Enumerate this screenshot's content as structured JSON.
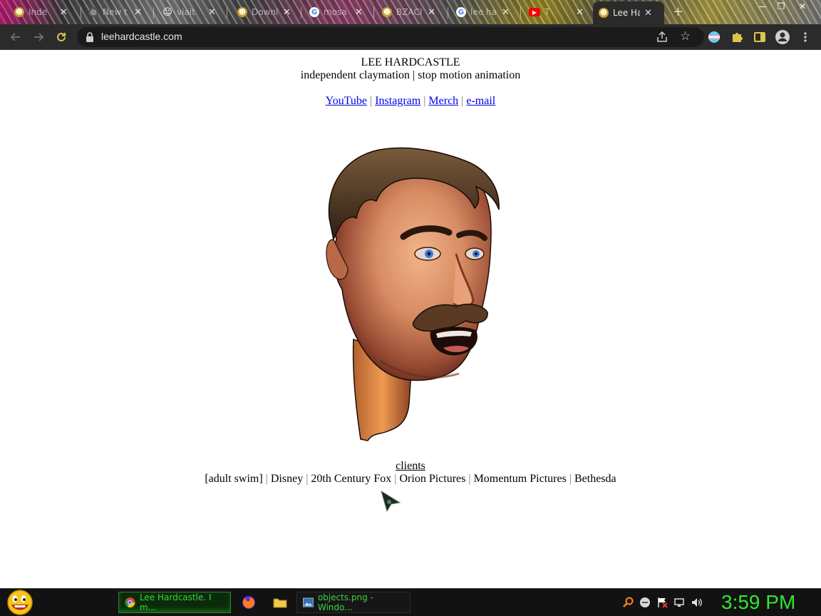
{
  "browser": {
    "tabs": [
      {
        "title": "Inde",
        "favicon": "claymation-favicon",
        "color": "#c9a227"
      },
      {
        "title": "New t",
        "favicon": "chrome-favicon",
        "color": "#555555"
      },
      {
        "title": "viait",
        "favicon": "smiley-favicon",
        "color": "#777777"
      },
      {
        "title": "Downl",
        "favicon": "claymation-favicon",
        "color": "#c9a227"
      },
      {
        "title": "mosa",
        "favicon": "google-favicon",
        "color": "#4285f4"
      },
      {
        "title": "BZACI",
        "favicon": "claymation-favicon",
        "color": "#c9a227"
      },
      {
        "title": "lee ha",
        "favicon": "google-favicon",
        "color": "#4285f4"
      },
      {
        "title": "T",
        "favicon": "youtube-favicon",
        "color": "#ff0000"
      },
      {
        "title": "Lee Ha",
        "favicon": "claymation-favicon",
        "color": "#c9a227",
        "active": true
      }
    ],
    "address_bar": {
      "url": "leehardcastle.com"
    }
  },
  "page": {
    "title": "LEE HARDCASTLE",
    "subtitle": "independent claymation | stop motion animation",
    "nav": [
      {
        "label": "YouTube"
      },
      {
        "label": "Instagram"
      },
      {
        "label": "Merch"
      },
      {
        "label": "e-mail"
      }
    ],
    "separator": "|",
    "portrait_icon": "clay-head-image",
    "clients_label": "clients",
    "clients": [
      "[adult swim]",
      "Disney",
      "20th Century Fox",
      "Orion Pictures",
      "Momentum Pictures",
      "Bethesda"
    ]
  },
  "taskbar": {
    "tasks": [
      {
        "label": "Lee Hardcastle. I m...",
        "icon": "chrome-icon"
      },
      {
        "label": "objects.png - Windo...",
        "icon": "image-viewer-icon"
      }
    ],
    "clock": "3:59 PM"
  },
  "colors": {
    "link": "#0000ee",
    "clock": "#2ee82e",
    "toolbar": "#2b2b2b"
  }
}
